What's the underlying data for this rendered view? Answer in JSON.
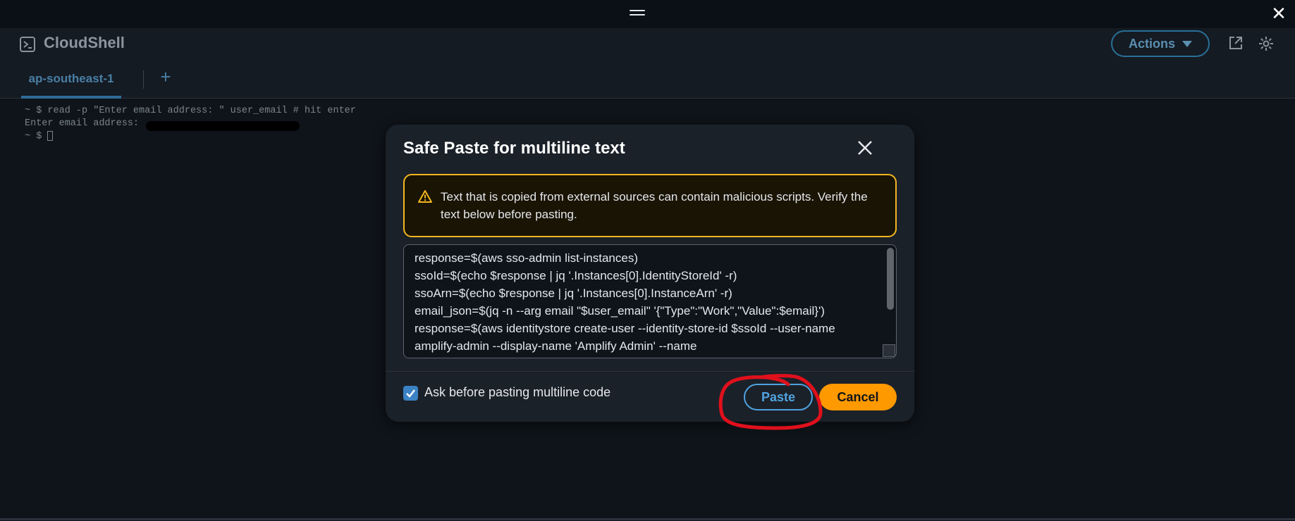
{
  "window": {
    "close_glyph": "✕"
  },
  "header": {
    "title": "CloudShell",
    "actions_label": "Actions"
  },
  "tabs": {
    "items": [
      {
        "label": "ap-southeast-1"
      }
    ],
    "add_glyph": "+"
  },
  "terminal": {
    "lines": [
      "~ $ read -p \"Enter email address: \" user_email # hit enter",
      "Enter email address: ",
      "~ $ "
    ]
  },
  "modal": {
    "title": "Safe Paste for multiline text",
    "warning_text": "Text that is copied from external sources can contain malicious scripts. Verify the text below before pasting.",
    "code_lines": [
      "response=$(aws sso-admin list-instances)",
      "ssoId=$(echo $response | jq '.Instances[0].IdentityStoreId' -r)",
      "ssoArn=$(echo $response | jq '.Instances[0].InstanceArn' -r)",
      "email_json=$(jq -n --arg email \"$user_email\" '{\"Type\":\"Work\",\"Value\":$email}')",
      "response=$(aws identitystore create-user --identity-store-id $ssoId --user-name",
      "amplify-admin --display-name 'Amplify Admin' --name"
    ],
    "checkbox_label": "Ask before pasting multiline code",
    "checkbox_checked": true,
    "paste_label": "Paste",
    "cancel_label": "Cancel"
  },
  "colors": {
    "accent_orange": "#ff9900",
    "accent_blue": "#4fa3e0",
    "warning_border": "#f2b71f",
    "annotation_red": "#e0101c"
  }
}
